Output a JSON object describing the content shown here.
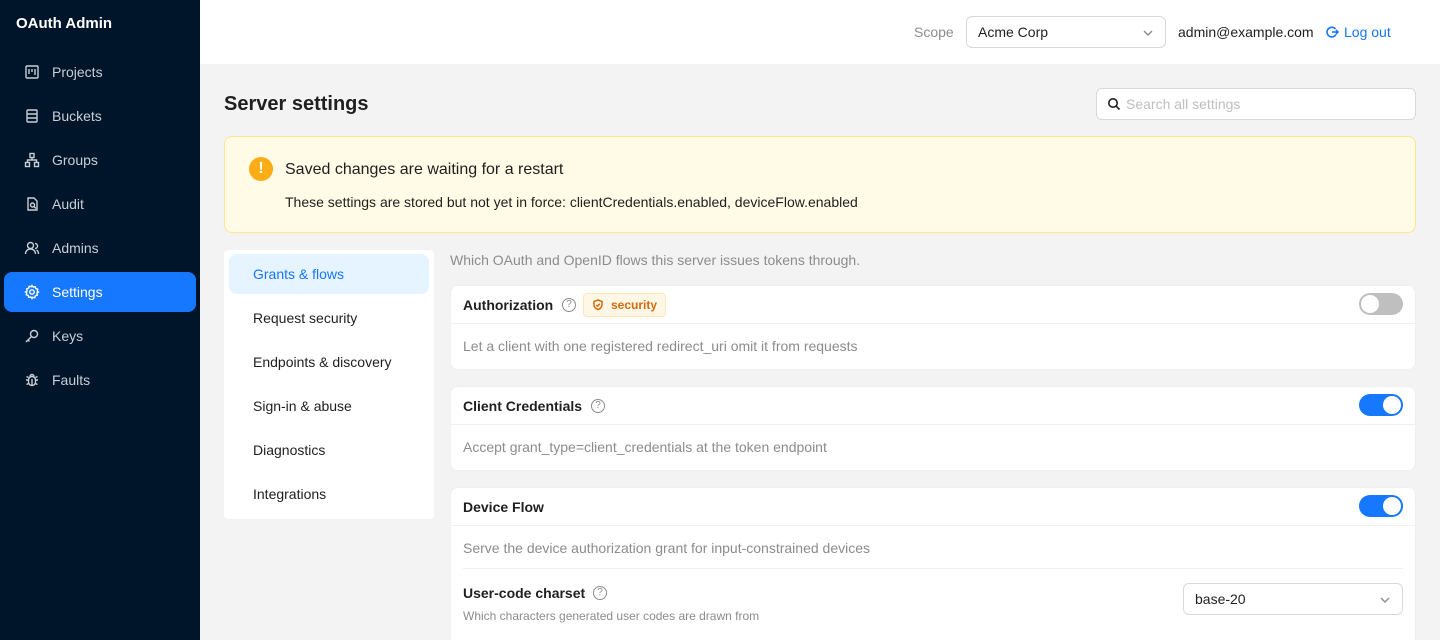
{
  "brand": "OAuth Admin",
  "sidebar": {
    "items": [
      {
        "label": "Projects",
        "icon": "projects-icon"
      },
      {
        "label": "Buckets",
        "icon": "buckets-icon"
      },
      {
        "label": "Groups",
        "icon": "groups-icon"
      },
      {
        "label": "Audit",
        "icon": "audit-icon"
      },
      {
        "label": "Admins",
        "icon": "admins-icon"
      },
      {
        "label": "Settings",
        "icon": "gear-icon",
        "active": true
      },
      {
        "label": "Keys",
        "icon": "key-icon"
      },
      {
        "label": "Faults",
        "icon": "bug-icon"
      }
    ]
  },
  "header": {
    "scope_label": "Scope",
    "scope_value": "Acme Corp",
    "user_email": "admin@example.com",
    "logout_label": "Log out"
  },
  "page": {
    "title": "Server settings",
    "search_placeholder": "Search all settings"
  },
  "alert": {
    "title": "Saved changes are waiting for a restart",
    "description": "These settings are stored but not yet in force: clientCredentials.enabled, deviceFlow.enabled",
    "icon": "warning-icon"
  },
  "subnav": {
    "items": [
      {
        "label": "Grants & flows",
        "active": true
      },
      {
        "label": "Request security"
      },
      {
        "label": "Endpoints & discovery"
      },
      {
        "label": "Sign-in & abuse"
      },
      {
        "label": "Diagnostics"
      },
      {
        "label": "Integrations"
      }
    ]
  },
  "section": {
    "description": "Which OAuth and OpenID flows this server issues tokens through."
  },
  "settings": [
    {
      "title": "Authorization",
      "tag": "security",
      "enabled": false,
      "description": "Let a client with one registered redirect_uri omit it from requests"
    },
    {
      "title": "Client Credentials",
      "enabled": true,
      "description": "Accept grant_type=client_credentials at the token endpoint"
    },
    {
      "title": "Device Flow",
      "enabled": true,
      "description": "Serve the device authorization grant for input-constrained devices",
      "sub": {
        "title": "User-code charset",
        "description": "Which characters generated user codes are drawn from",
        "value": "base-20"
      }
    }
  ],
  "colors": {
    "sidebar_bg": "#001529",
    "accent": "#1677ff",
    "alert_bg": "#fffbe6",
    "warning": "#faad14",
    "tag_text": "#d46b08"
  }
}
